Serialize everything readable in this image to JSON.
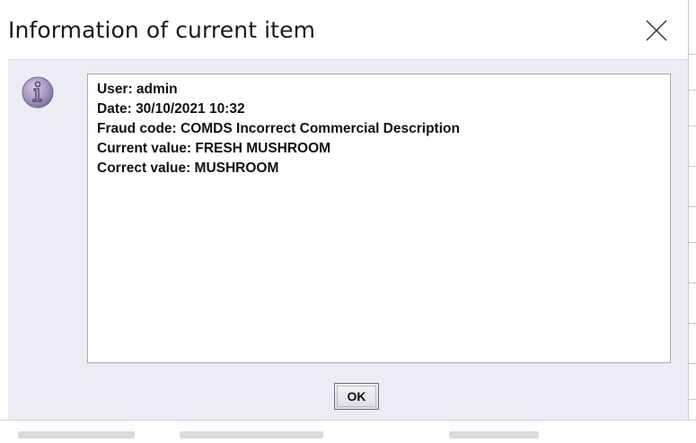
{
  "dialog": {
    "title": "Information of current item",
    "close_icon": "close-icon",
    "message_icon": "information-icon",
    "message_lines": [
      "User: admin",
      "Date: 30/10/2021 10:32",
      "Fraud code: COMDS Incorrect Commercial Description",
      "Current value: FRESH MUSHROOM",
      "Correct value: MUSHROOM"
    ],
    "ok_label": "OK"
  },
  "colors": {
    "content_background": "#ececf4",
    "icon_purple": "#9e8fb8",
    "title_text": "#1a1a1a"
  }
}
